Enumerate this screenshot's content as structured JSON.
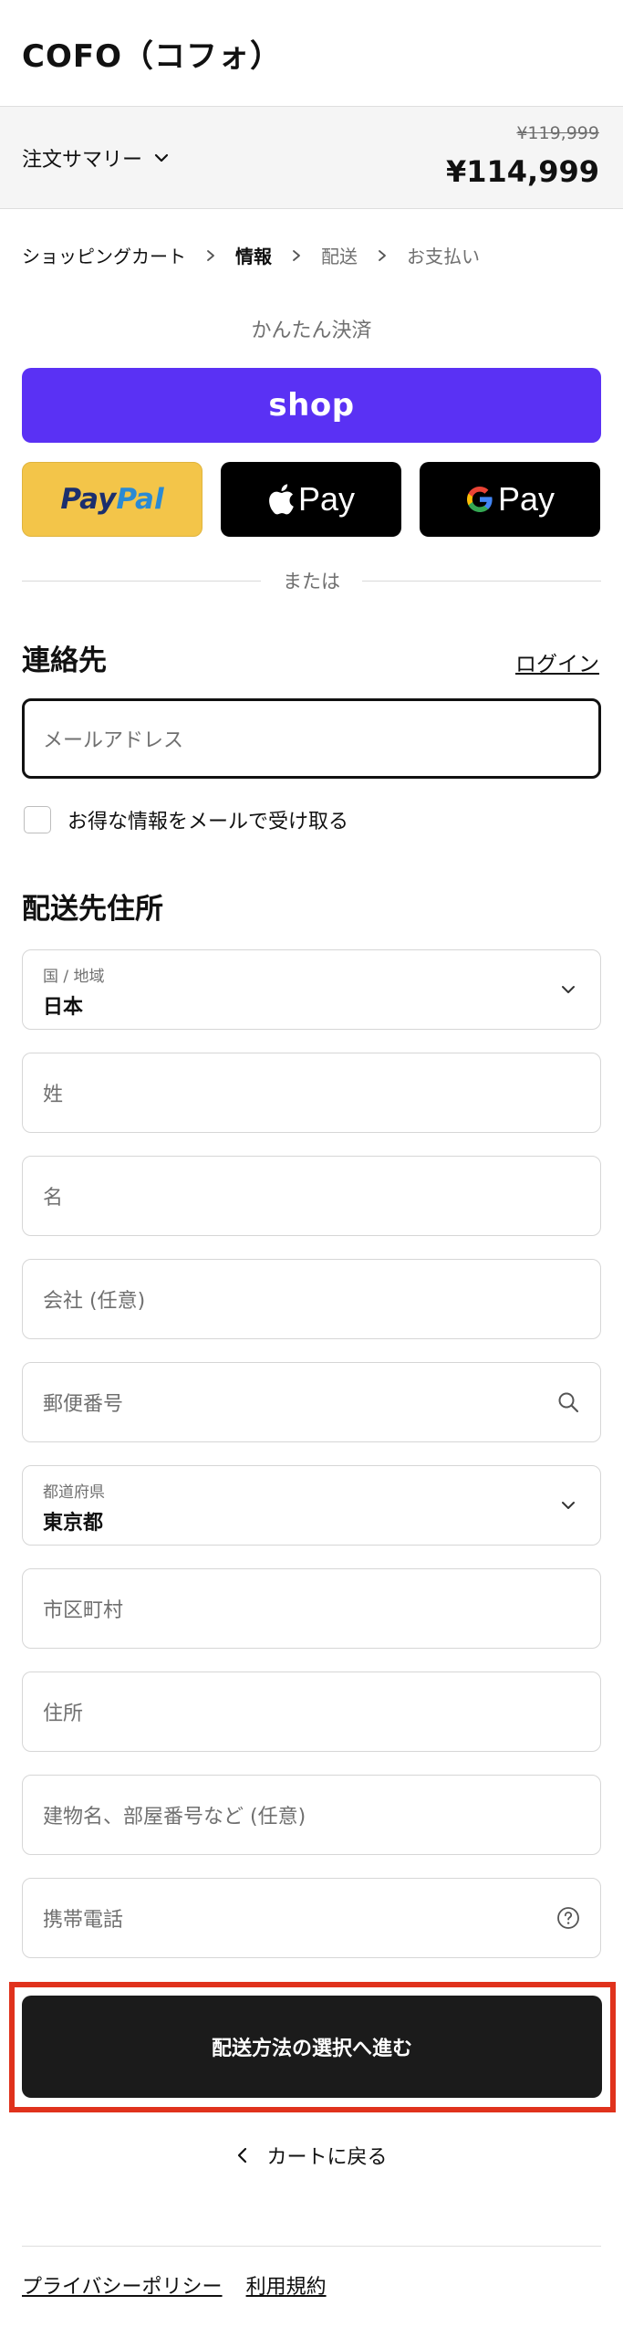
{
  "header": {
    "store_name": "COFO（コフォ）"
  },
  "summary": {
    "toggle_label": "注文サマリー",
    "compare_price": "¥119,999",
    "total_price": "¥114,999"
  },
  "breadcrumb": {
    "items": [
      "ショッピングカート",
      "情報",
      "配送",
      "お支払い"
    ]
  },
  "express": {
    "title": "かんたん決済",
    "shop_label": "shop",
    "paypal_part1": "Pay",
    "paypal_part2": "Pal",
    "apple_pay_label": "Pay",
    "google_pay_label": "Pay",
    "divider_text": "または"
  },
  "contact": {
    "heading": "連絡先",
    "login_label": "ログイン",
    "email_placeholder": "メールアドレス",
    "newsletter_label": "お得な情報をメールで受け取る"
  },
  "shipping": {
    "heading": "配送先住所",
    "country_label": "国 / 地域",
    "country_value": "日本",
    "last_name_placeholder": "姓",
    "first_name_placeholder": "名",
    "company_placeholder": "会社 (任意)",
    "postal_placeholder": "郵便番号",
    "prefecture_label": "都道府県",
    "prefecture_value": "東京都",
    "city_placeholder": "市区町村",
    "address_placeholder": "住所",
    "building_placeholder": "建物名、部屋番号など (任意)",
    "phone_placeholder": "携帯電話"
  },
  "actions": {
    "continue_label": "配送方法の選択へ進む",
    "back_label": "カートに戻る"
  },
  "footer": {
    "privacy_label": "プライバシーポリシー",
    "terms_label": "利用規約"
  },
  "colors": {
    "shop_purple": "#5a31f4",
    "paypal_yellow": "#f3c549",
    "highlight_red": "#e0321c",
    "cta_dark": "#1b1b1b"
  }
}
